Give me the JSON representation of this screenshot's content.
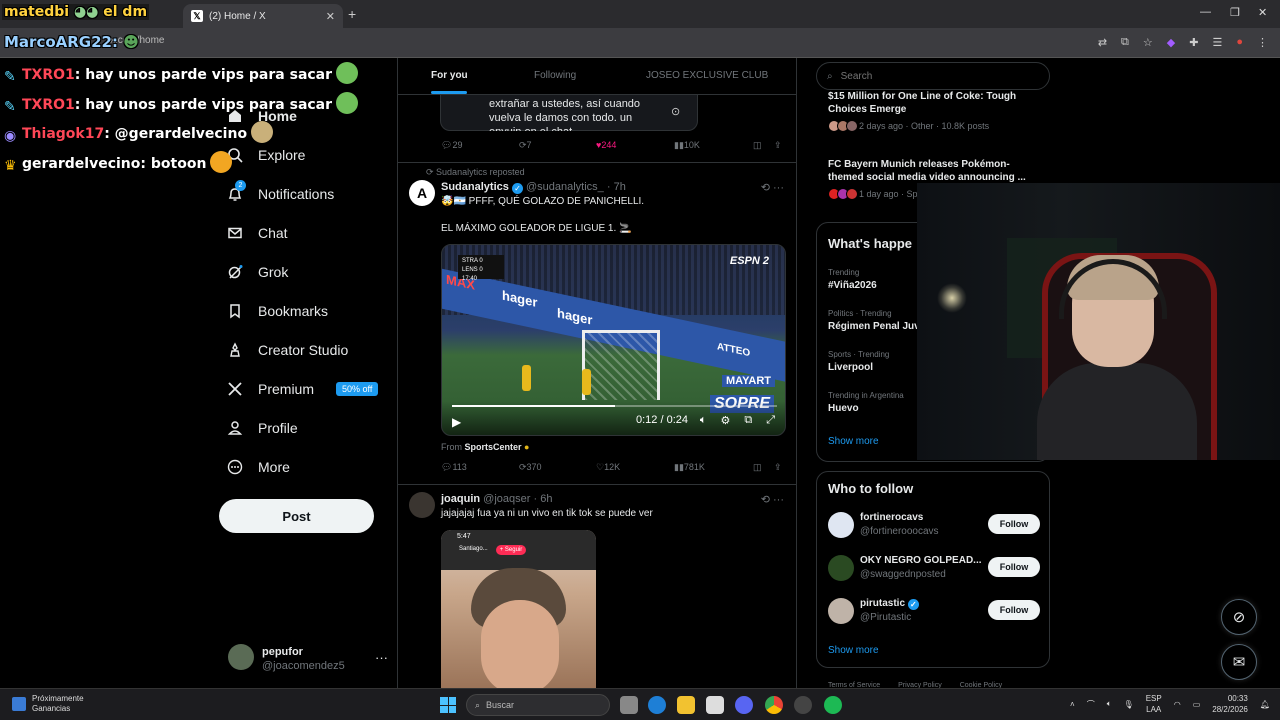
{
  "browser": {
    "tab_title": "(2) Home / X",
    "url": "x.com/home",
    "colors": {
      "tabstrip": "#2b2b2e",
      "toolbar": "#3c3c40"
    }
  },
  "chat_overlay": {
    "handle_top": "matedbi",
    "handle_top_suffix": "el dm",
    "handle_bottom": "MarcoARG22:",
    "messages": [
      {
        "user": "TXRO1",
        "text": ": hay unos parde vips para sacar"
      },
      {
        "user": "TXRO1",
        "text": ": hay unos parde vips para sacar"
      },
      {
        "user": "Thiagok17",
        "text": ": @gerardelvecino"
      },
      {
        "user": "gerardelvecino",
        "text": ": botoon"
      }
    ]
  },
  "nav": {
    "items": [
      {
        "label": "Home",
        "icon": "home-icon"
      },
      {
        "label": "Explore",
        "icon": "search-icon"
      },
      {
        "label": "Notifications",
        "icon": "bell-icon",
        "badge": "2"
      },
      {
        "label": "Chat",
        "icon": "mail-icon"
      },
      {
        "label": "Grok",
        "icon": "grok-icon"
      },
      {
        "label": "Bookmarks",
        "icon": "bookmark-icon"
      },
      {
        "label": "Creator Studio",
        "icon": "creator-studio-icon"
      },
      {
        "label": "Premium",
        "icon": "x-logo-icon",
        "promo": "50% off"
      },
      {
        "label": "Profile",
        "icon": "person-icon"
      },
      {
        "label": "More",
        "icon": "more-circle-icon"
      }
    ],
    "post_label": "Post",
    "account": {
      "name": "pepufor",
      "handle": "@joacomendez5"
    }
  },
  "timeline": {
    "tabs": [
      "For you",
      "Following",
      "JOSEO EXCLUSIVE CLUB"
    ],
    "quote_text": "extrañar a ustedes, así cuando vuelva le damos con todo. un envuin en el chat",
    "first_actions": {
      "replies": "29",
      "reposts": "7",
      "likes": "244",
      "views": "10K"
    },
    "tweet1": {
      "repost_by": "Sudanalytics reposted",
      "name": "Sudanalytics",
      "handle": "@sudanalytics_",
      "time": "· 7h",
      "line1": "🤯🇦🇷 PFFF, QUÉ GOLAZO DE PANICHELLI.",
      "line2": "EL MÁXIMO GOLEADOR DE LIGUE 1. 🚬",
      "video": {
        "time": "0:12 / 0:24",
        "progress": 0.5,
        "broadcaster": "ESPN 2",
        "scorebug": [
          "STRA 0",
          "LENS 0",
          "17:40"
        ],
        "ads": [
          "MAX",
          "hager",
          "hager",
          "ATTEO",
          "MAYART",
          "SOPRE"
        ]
      },
      "from_label": "From",
      "from_source": "SportsCenter",
      "actions": {
        "replies": "113",
        "reposts": "370",
        "likes": "12K",
        "views": "781K"
      }
    },
    "tweet2": {
      "name": "joaquin",
      "handle": "@joaqser",
      "time": "· 6h",
      "text": "jajajajaj fua ya ni un vivo en tik tok se puede ver",
      "phone_time": "5:47",
      "phone_follow": "+ Seguir",
      "phone_user": "Santiago..."
    }
  },
  "right": {
    "search_placeholder": "Search",
    "news": [
      {
        "title": "$15 Million for One Line of Coke: Tough Choices Emerge",
        "meta": "2 days ago · Other · 10.8K posts"
      },
      {
        "title": "FC Bayern Munich releases Pokémon-themed social media video announcing ...",
        "meta": "1 day ago · Sp"
      }
    ],
    "whats_happening": "What's happe",
    "trends": [
      {
        "context": "Trending",
        "name": "#Viña2026"
      },
      {
        "context": "Politics · Trending",
        "name": "Régimen Penal Juv"
      },
      {
        "context": "Sports · Trending",
        "name": "Liverpool"
      },
      {
        "context": "Trending in Argentina",
        "name": "Huevo"
      }
    ],
    "show_more": "Show more",
    "who_to_follow": "Who to follow",
    "follow_suggestions": [
      {
        "name": "fortinerocavs",
        "handle": "@fortinerooocavs",
        "verified": false
      },
      {
        "name": "OKY NEGRO GOLPEAD...",
        "handle": "@swaggednposted",
        "verified": false
      },
      {
        "name": "pirutastic",
        "handle": "@Pirutastic",
        "verified": true
      }
    ],
    "follow_label": "Follow",
    "footer": [
      "Terms of Service",
      "Privacy Policy",
      "Cookie Policy"
    ]
  },
  "taskbar": {
    "weather_line1": "Próximamente",
    "weather_line2": "Ganancias",
    "search": "Buscar",
    "lang1": "ESP",
    "lang2": "LAA",
    "time": "00:33",
    "date": "28/2/2026"
  }
}
